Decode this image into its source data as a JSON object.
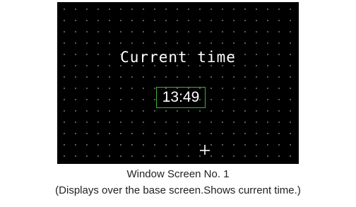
{
  "screen": {
    "title": "Current time",
    "time_display": "13:49",
    "background_color": "#000000",
    "grid_dot_color": "#6e6e6e",
    "time_border_color": "#37b437",
    "cursor_icon": "crosshair-cursor-icon"
  },
  "caption": {
    "line1": "Window Screen No. 1",
    "line2": "(Displays over the base screen.Shows current time.)"
  }
}
